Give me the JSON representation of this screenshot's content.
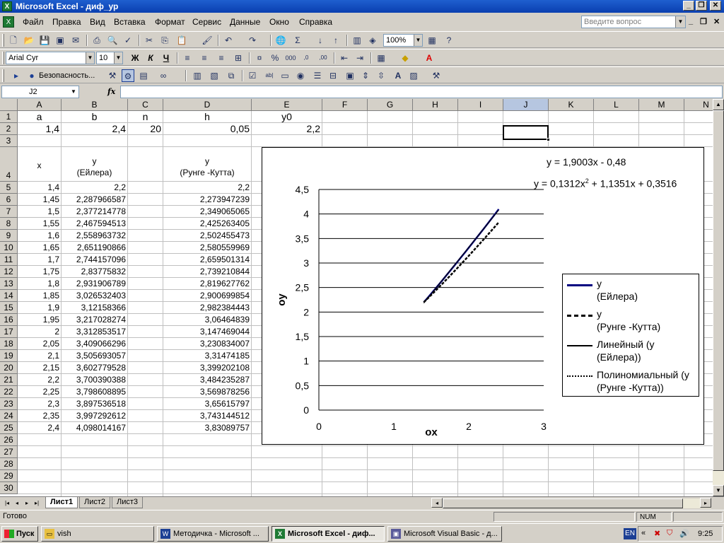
{
  "window": {
    "title": "Microsoft Excel - диф_ур"
  },
  "menu": {
    "items": [
      "Файл",
      "Правка",
      "Вид",
      "Вставка",
      "Формат",
      "Сервис",
      "Данные",
      "Окно",
      "Справка"
    ],
    "help_placeholder": "Введите вопрос"
  },
  "toolbar": {
    "zoom": "100%",
    "font_name": "Arial Cyr",
    "font_size": "10",
    "bold_label": "Ж",
    "italic_label": "К",
    "underline_label": "Ч",
    "security_label": "Безопасность..."
  },
  "formula_bar": {
    "name_box": "J2",
    "fx_label": "fx",
    "content": ""
  },
  "columns": [
    "A",
    "B",
    "C",
    "D",
    "E",
    "F",
    "G",
    "H",
    "I",
    "J",
    "K",
    "L",
    "M",
    "N"
  ],
  "rows": [
    "1",
    "2",
    "3",
    "4",
    "5",
    "6",
    "7",
    "8",
    "9",
    "10",
    "11",
    "12",
    "13",
    "14",
    "15",
    "16",
    "17",
    "18",
    "19",
    "20",
    "21",
    "22",
    "23",
    "24",
    "25",
    "26",
    "27",
    "28",
    "29",
    "30"
  ],
  "cells": {
    "A1": "a",
    "B1": "b",
    "C1": "n",
    "D1": "h",
    "E1": "y0",
    "A2": "1,4",
    "B2": "2,4",
    "C2": "20",
    "D2": "0,05",
    "E2": "2,2",
    "A4": "x",
    "B4_line1": "y",
    "B4_line2": "(Ейлера)",
    "D4_line1": "y",
    "D4_line2": "(Рунге -Кутта)"
  },
  "table": {
    "x": [
      "1,4",
      "1,45",
      "1,5",
      "1,55",
      "1,6",
      "1,65",
      "1,7",
      "1,75",
      "1,8",
      "1,85",
      "1,9",
      "1,95",
      "2",
      "2,05",
      "2,1",
      "2,15",
      "2,2",
      "2,25",
      "2,3",
      "2,35",
      "2,4"
    ],
    "euler": [
      "2,2",
      "2,287966587",
      "2,377214778",
      "2,467594513",
      "2,558963732",
      "2,651190866",
      "2,744157096",
      "2,83775832",
      "2,931906789",
      "3,026532403",
      "3,12158366",
      "3,217028274",
      "3,312853517",
      "3,409066296",
      "3,505693057",
      "3,602779528",
      "3,700390388",
      "3,798608895",
      "3,897536518",
      "3,997292612",
      "4,098014167"
    ],
    "rk": [
      "2,2",
      "2,273947239",
      "2,349065065",
      "2,425263405",
      "2,502455473",
      "2,580559969",
      "2,659501314",
      "2,739210844",
      "2,819627762",
      "2,900699854",
      "2,982384443",
      "3,06464839",
      "3,147469044",
      "3,230834007",
      "3,31474185",
      "3,399202108",
      "3,484235287",
      "3,569878256",
      "3,65615797",
      "3,743144512",
      "3,83089757"
    ]
  },
  "chart_data": {
    "type": "line",
    "xlabel": "ox",
    "ylabel": "oy",
    "xlim": [
      0,
      3
    ],
    "ylim": [
      0,
      4.5
    ],
    "x_ticks": [
      "0",
      "1",
      "2",
      "3"
    ],
    "y_ticks": [
      "0",
      "0,5",
      "1",
      "1,5",
      "2",
      "2,5",
      "3",
      "3,5",
      "4",
      "4,5"
    ],
    "grid": true,
    "legend_position": "right",
    "x": [
      1.4,
      1.45,
      1.5,
      1.55,
      1.6,
      1.65,
      1.7,
      1.75,
      1.8,
      1.85,
      1.9,
      1.95,
      2,
      2.05,
      2.1,
      2.15,
      2.2,
      2.25,
      2.3,
      2.35,
      2.4
    ],
    "series": [
      {
        "name_line1": "y",
        "name_line2": "(Ейлера)",
        "style": "solid-thick",
        "color": "#000080",
        "values": [
          2.2,
          2.288,
          2.377,
          2.468,
          2.559,
          2.651,
          2.744,
          2.838,
          2.932,
          3.027,
          3.122,
          3.217,
          3.313,
          3.409,
          3.506,
          3.603,
          3.7,
          3.799,
          3.898,
          3.997,
          4.098
        ]
      },
      {
        "name_line1": "y",
        "name_line2": "(Рунге -Кутта)",
        "style": "dashed-thick",
        "color": "#000000",
        "values": [
          2.2,
          2.274,
          2.349,
          2.425,
          2.502,
          2.581,
          2.66,
          2.739,
          2.82,
          2.901,
          2.982,
          3.065,
          3.147,
          3.231,
          3.315,
          3.399,
          3.484,
          3.57,
          3.656,
          3.743,
          3.831
        ]
      },
      {
        "name_line1": "Линейный (y",
        "name_line2": "(Ейлера))",
        "style": "solid-thin",
        "color": "#000000"
      },
      {
        "name_line1": "Полиномиальный (y",
        "name_line2": "(Рунге -Кутта))",
        "style": "dotted-thin",
        "color": "#000000"
      }
    ],
    "equations": {
      "linear": "y = 1,9003x - 0,48",
      "poly_a": "y = 0,1312x",
      "poly_exp": "2",
      "poly_b": " + 1,1351x + 0,3516"
    }
  },
  "sheets": [
    "Лист1",
    "Лист2",
    "Лист3"
  ],
  "status": {
    "ready": "Готово",
    "num": "NUM"
  },
  "taskbar": {
    "start": "Пуск",
    "tasks": [
      "vish",
      "Методичка - Microsoft ...",
      "Microsoft Excel - диф...",
      "Microsoft Visual Basic - д..."
    ],
    "lang": "EN",
    "clock": "9:25"
  }
}
